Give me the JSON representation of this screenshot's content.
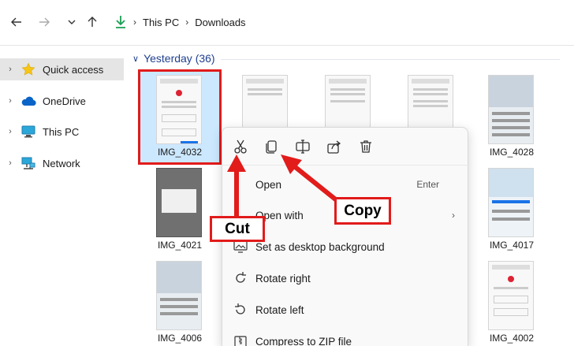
{
  "colors": {
    "accent": "#0067c0",
    "annotation_red": "#e21b1b",
    "selected_bg": "#cce8ff",
    "group_header": "#1f3f8f"
  },
  "address": {
    "crumbs": [
      "This PC",
      "Downloads"
    ],
    "location_icon": "download-arrow-icon"
  },
  "sidebar": {
    "items": [
      {
        "label": "Quick access",
        "icon": "star-icon",
        "selected": true
      },
      {
        "label": "OneDrive",
        "icon": "cloud-icon"
      },
      {
        "label": "This PC",
        "icon": "monitor-icon"
      },
      {
        "label": "Network",
        "icon": "network-icon"
      }
    ]
  },
  "main": {
    "group": {
      "label": "Yesterday (36)"
    },
    "files": [
      {
        "name": "IMG_4032",
        "selected": true
      },
      {
        "name": "IMG_4028"
      },
      {
        "name": "IMG_4021"
      },
      {
        "name": "IMG_4017"
      },
      {
        "name": "IMG_4006"
      },
      {
        "name": "IMG_4002"
      }
    ]
  },
  "context_menu": {
    "toolbar": [
      "cut-icon",
      "copy-icon",
      "rename-icon",
      "share-icon",
      "delete-icon"
    ],
    "items": [
      {
        "label": "Open",
        "shortcut": "Enter"
      },
      {
        "label": "Open with",
        "submenu": true
      },
      {
        "label": "Set as desktop background"
      },
      {
        "label": "Rotate right"
      },
      {
        "label": "Rotate left"
      },
      {
        "label": "Compress to ZIP file"
      }
    ]
  },
  "annotations": {
    "cut": "Cut",
    "copy": "Copy"
  }
}
